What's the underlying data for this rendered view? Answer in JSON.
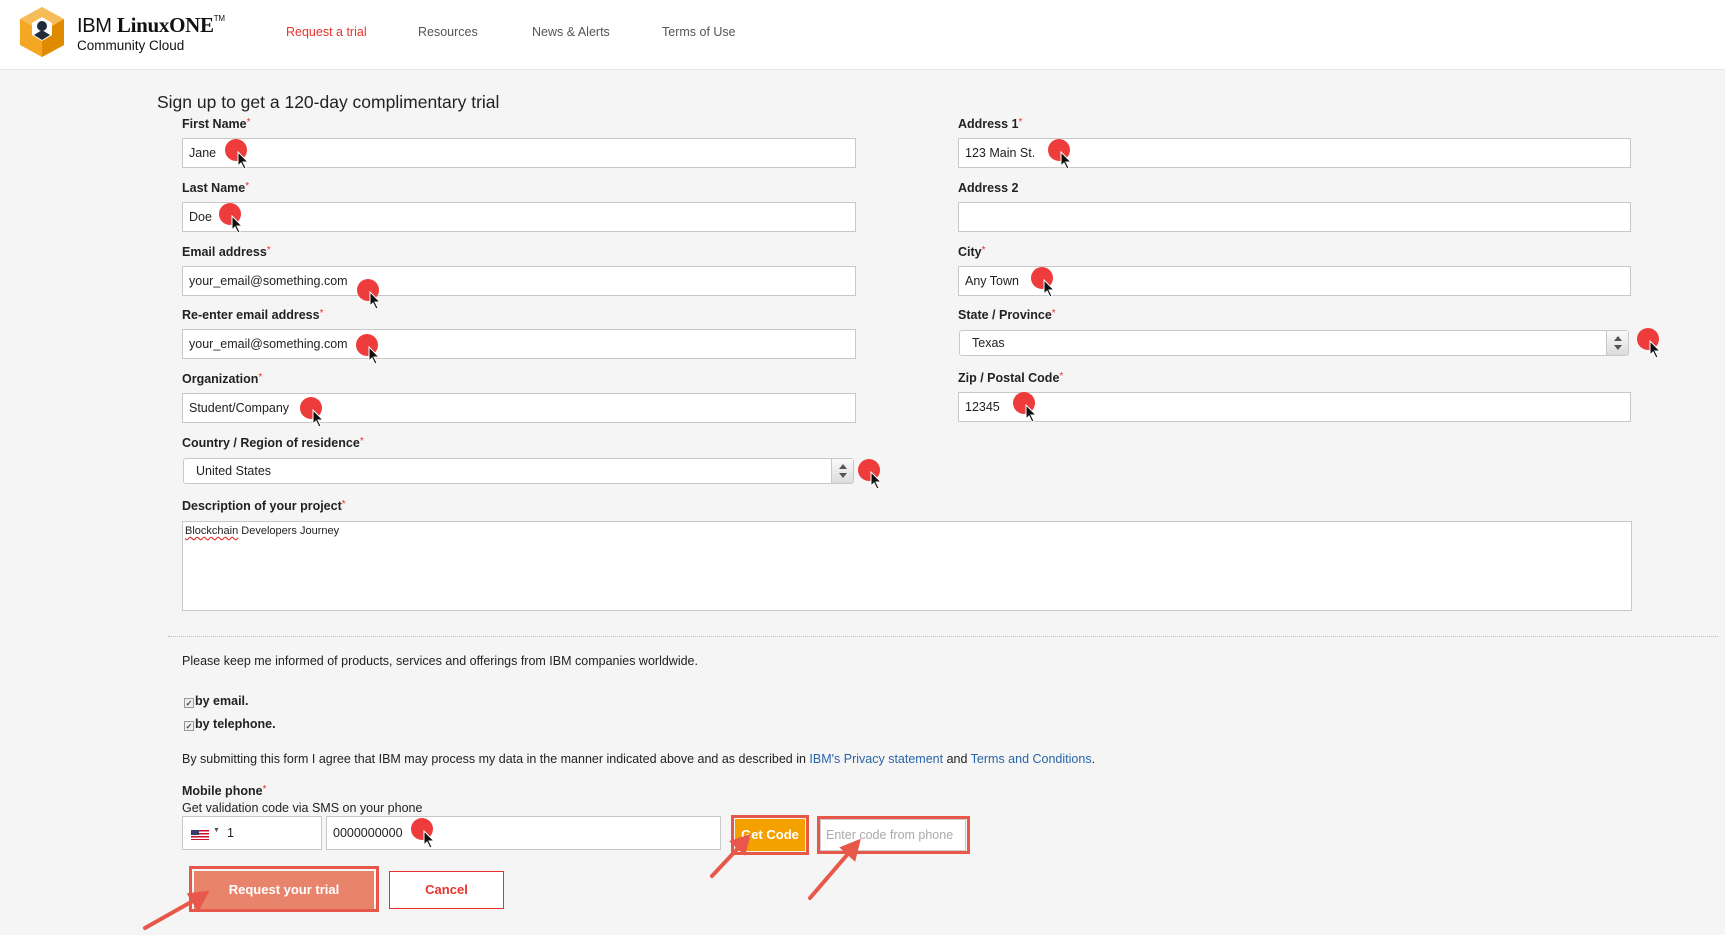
{
  "header": {
    "brand_line1_a": "IBM ",
    "brand_line1_b": "LinuxONE",
    "brand_tm": "TM",
    "brand_line2": "Community Cloud",
    "nav": {
      "request_trial": "Request a trial",
      "resources": "Resources",
      "news_alerts": "News & Alerts",
      "terms_of_use": "Terms of Use"
    }
  },
  "form": {
    "title": "Sign up to get a 120-day complimentary trial",
    "required_mark": "*",
    "first_name": {
      "label": "First Name",
      "value": "Jane"
    },
    "last_name": {
      "label": "Last Name",
      "value": "Doe"
    },
    "email": {
      "label": "Email address",
      "value": "your_email@something.com"
    },
    "email_confirm": {
      "label": "Re-enter email address",
      "value": "your_email@something.com"
    },
    "organization": {
      "label": "Organization",
      "value": "Student/Company"
    },
    "country": {
      "label": "Country / Region of residence",
      "value": "United States"
    },
    "description": {
      "label": "Description of your project",
      "value_word1": "Blockchain",
      "value_rest": " Developers Journey"
    },
    "address1": {
      "label": "Address 1",
      "value": "123 Main St."
    },
    "address2": {
      "label": "Address 2",
      "value": ""
    },
    "city": {
      "label": "City",
      "value": "Any Town"
    },
    "state": {
      "label": "State / Province",
      "value": "Texas"
    },
    "zip": {
      "label": "Zip / Postal Code",
      "value": "12345"
    }
  },
  "consent": {
    "keep_informed": "Please keep me informed of products, services and offerings from IBM companies worldwide.",
    "by_email": "by email.",
    "by_telephone": "by telephone.",
    "check_glyph": "✓",
    "agree_text_1": "By submitting this form I agree that IBM may process my data in the manner indicated above and as described in ",
    "privacy_link": "IBM's Privacy statement",
    "agree_text_2": " and ",
    "terms_link": "Terms and Conditions",
    "agree_text_3": "."
  },
  "phone": {
    "label": "Mobile phone",
    "hint": "Get validation code via SMS on your phone",
    "country_code": "1",
    "dropdown_glyph": "▼",
    "number": "0000000000",
    "get_code_label": "Get Code",
    "code_placeholder": "Enter code from phone"
  },
  "actions": {
    "request_label": "Request your trial",
    "cancel_label": "Cancel"
  },
  "colors": {
    "accent_red": "#e8322b",
    "annotation_red": "#ee3b3b",
    "get_code_yellow": "#f4a100",
    "request_button": "#e8846b",
    "link_blue": "#2a64a8"
  },
  "icons": {
    "logo": "ibm-linuxone-logo-icon",
    "cursor": "mouse-pointer-icon",
    "flag": "us-flag-icon",
    "stepper": "select-stepper-icon"
  }
}
